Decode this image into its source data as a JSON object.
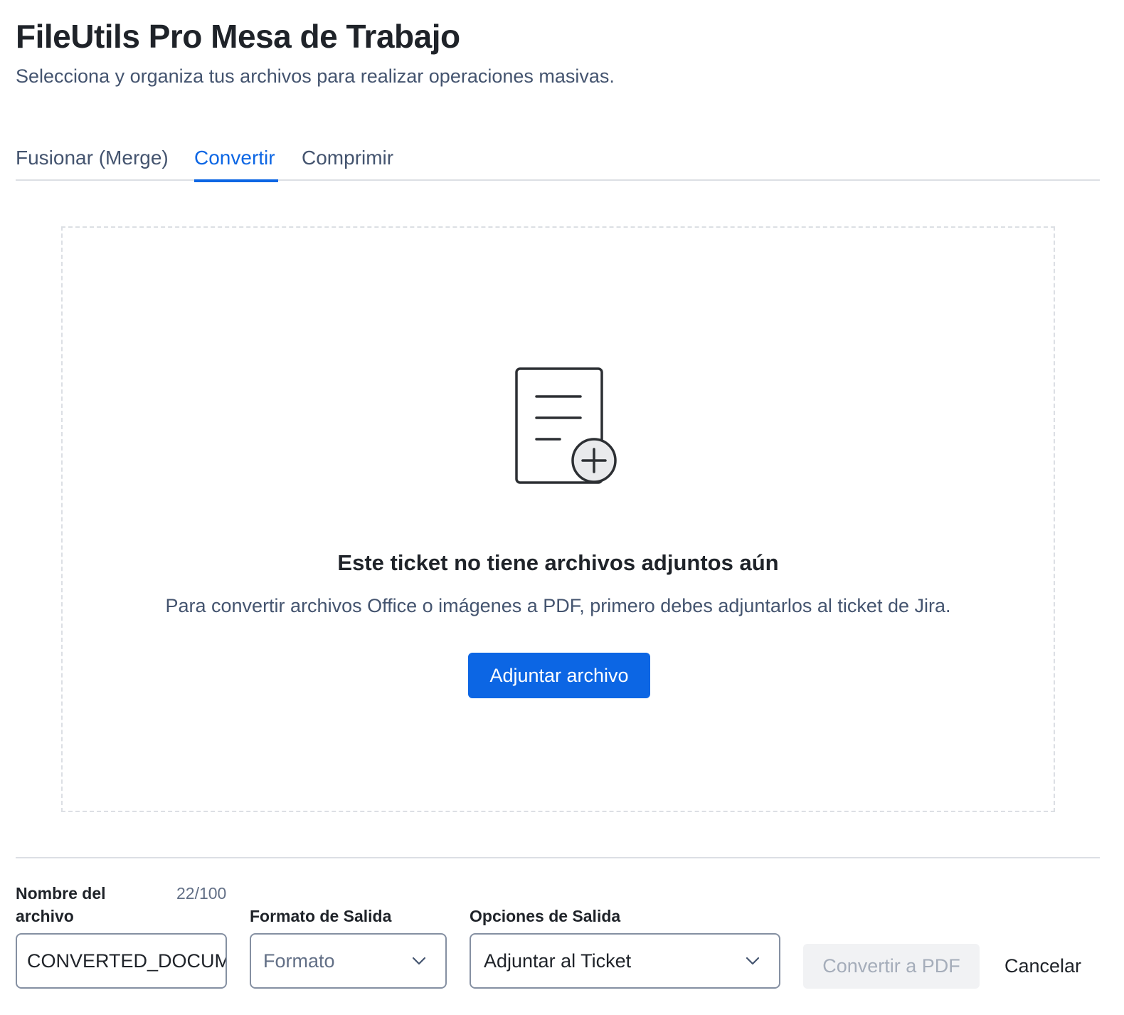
{
  "header": {
    "title": "FileUtils Pro Mesa de Trabajo",
    "subtitle": "Selecciona y organiza tus archivos para realizar operaciones masivas."
  },
  "tabs": [
    {
      "label": "Fusionar (Merge)",
      "active": false
    },
    {
      "label": "Convertir",
      "active": true
    },
    {
      "label": "Comprimir",
      "active": false
    }
  ],
  "empty_state": {
    "icon": "document-add-icon",
    "title": "Este ticket no tiene archivos adjuntos aún",
    "description": "Para convertir archivos Office o imágenes a PDF, primero debes adjuntarlos al ticket de Jira.",
    "button_label": "Adjuntar archivo"
  },
  "form": {
    "filename_label": "Nombre del archivo",
    "filename_counter": "22/100",
    "filename_value": "CONVERTED_DOCUMENT",
    "format_label": "Formato de Salida",
    "format_placeholder": "Formato",
    "options_label": "Opciones de Salida",
    "options_value": "Adjuntar al Ticket",
    "convert_label": "Convertir a PDF",
    "cancel_label": "Cancelar"
  },
  "colors": {
    "accent": "#0c66e4",
    "text": "#1f2329",
    "muted": "#44546f",
    "disabled_bg": "#f1f2f4",
    "disabled_text": "#a5adba"
  }
}
